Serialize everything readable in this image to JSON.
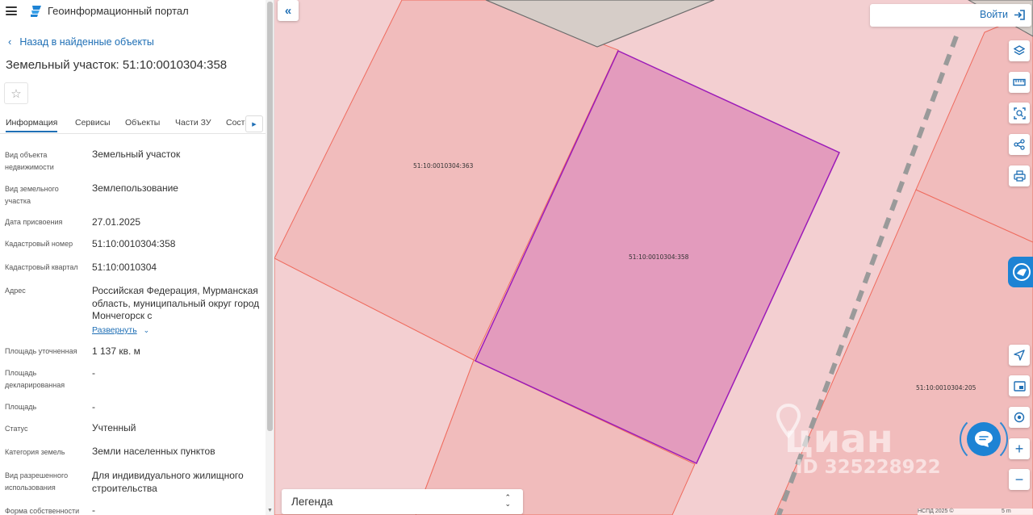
{
  "header": {
    "portal_title": "Геоинформационный портал"
  },
  "nav": {
    "back_label": "Назад в найденные объекты"
  },
  "object": {
    "title": "Земельный участок: 51:10:0010304:358"
  },
  "tabs": [
    {
      "label": "Информация",
      "active": true
    },
    {
      "label": "Сервисы"
    },
    {
      "label": "Объекты"
    },
    {
      "label": "Части ЗУ"
    },
    {
      "label": "Составы"
    }
  ],
  "properties": [
    {
      "key": "Вид объекта недвижимости",
      "value": "Земельный участок"
    },
    {
      "key": "Вид земельного участка",
      "value": "Землепользование"
    },
    {
      "key": "Дата присвоения",
      "value": "27.01.2025"
    },
    {
      "key": "Кадастровый номер",
      "value": "51:10:0010304:358"
    },
    {
      "key": "Кадастровый квартал",
      "value": "51:10:0010304"
    },
    {
      "key": "Адрес",
      "value": "Российская Федерация, Мурманская область, муниципальный округ город Мончегорск с"
    },
    {
      "key": "Площадь уточненная",
      "value": "1 137 кв. м"
    },
    {
      "key": "Площадь декларированная",
      "value": "-"
    },
    {
      "key": "Площадь",
      "value": "-"
    },
    {
      "key": "Статус",
      "value": "Учтенный"
    },
    {
      "key": "Категория земель",
      "value": "Земли населенных пунктов"
    },
    {
      "key": "Вид разрешенного использования",
      "value": "Для индивидуального жилищного строительства"
    },
    {
      "key": "Форма собственности",
      "value": "-"
    }
  ],
  "address_expand_label": "Развернуть",
  "map": {
    "login_label": "Войти",
    "legend_label": "Легенда",
    "plot_labels": {
      "selected": "51:10:0010304:358",
      "left": "51:10:0010304:363",
      "right": "51:10:0010304:205"
    },
    "colors": {
      "background": "#f3cfd1",
      "plot_fill": "#f1bcbc",
      "plot_stroke": "#ef6b5e",
      "selected_fill": "#e39bbd",
      "selected_stroke": "#9c1bb8",
      "accent": "#1d83d4"
    },
    "watermark": {
      "brand": "циан",
      "id": "ID 325228922"
    },
    "attribution": "НСПД 2025 ©",
    "scale_label": "5 m",
    "tools": [
      "layers-icon",
      "ruler-icon",
      "select-area-icon",
      "share-icon",
      "print-icon",
      "locate-icon",
      "minimap-icon",
      "geolocation-icon",
      "zoom-in-icon",
      "zoom-out-icon"
    ]
  }
}
